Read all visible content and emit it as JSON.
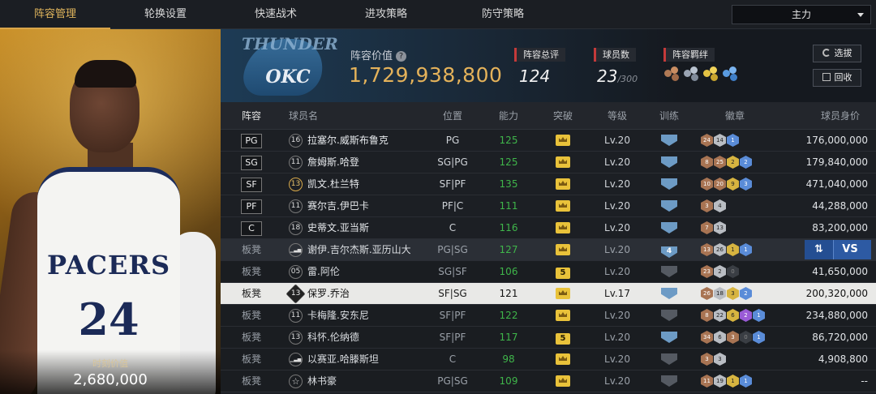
{
  "nav": {
    "tabs": [
      {
        "label": "阵容管理"
      },
      {
        "label": "轮换设置"
      },
      {
        "label": "快速战术"
      },
      {
        "label": "进攻策略"
      },
      {
        "label": "防守策略"
      }
    ],
    "lineup_select": "主力"
  },
  "portrait": {
    "jersey_team": "PACERS",
    "jersey_number": "24",
    "value_label": "时刻价值",
    "value_amount": "2,680,000"
  },
  "team": {
    "logo_text": "THUNDER",
    "logo_abbr": "OKC",
    "lineup_value_label": "阵容价值",
    "lineup_value": "1,729,938,800",
    "rating_label": "阵容总评",
    "rating": "124",
    "player_count_label": "球员数",
    "player_count": "23",
    "player_count_max": "/300",
    "bond_label": "阵容羁绊",
    "select_button": "选拔",
    "recycle_button": "回收"
  },
  "table": {
    "headers": {
      "lineup": "阵容",
      "name": "球员名",
      "position": "位置",
      "ability": "能力",
      "breakthrough": "突破",
      "level": "等级",
      "training": "训练",
      "badges": "徽章",
      "value": "球员身价"
    },
    "vs_label": "VS",
    "rows": [
      {
        "slot": "PG",
        "num": "16",
        "name": "拉塞尔.威斯布鲁克",
        "pos": "PG",
        "ability": "125",
        "level": "Lv.20",
        "value": "176,000,000"
      },
      {
        "slot": "SG",
        "num": "11",
        "name": "詹姆斯.哈登",
        "pos": "SG|PG",
        "ability": "125",
        "level": "Lv.20",
        "value": "179,840,000"
      },
      {
        "slot": "SF",
        "num": "13",
        "name": "凯文.杜兰特",
        "pos": "SF|PF",
        "ability": "135",
        "level": "Lv.20",
        "value": "471,040,000"
      },
      {
        "slot": "PF",
        "num": "11",
        "name": "赛尔吉.伊巴卡",
        "pos": "PF|C",
        "ability": "111",
        "level": "Lv.20",
        "value": "44,288,000"
      },
      {
        "slot": "C",
        "num": "18",
        "name": "史蒂文.亚当斯",
        "pos": "C",
        "ability": "116",
        "level": "Lv.20",
        "value": "83,200,000"
      },
      {
        "slot": "板凳",
        "num": "",
        "name": "谢伊.吉尔杰斯.亚历山大",
        "pos": "PG|SG",
        "ability": "127",
        "level": "Lv.20",
        "value": ""
      },
      {
        "slot": "板凳",
        "num": "05",
        "name": "雷.阿伦",
        "pos": "SG|SF",
        "ability": "106",
        "level": "Lv.20",
        "value": "41,650,000",
        "breakthrough": "5"
      },
      {
        "slot": "板凳",
        "num": "13",
        "name": "保罗.乔治",
        "pos": "SF|SG",
        "ability": "121",
        "level": "Lv.17",
        "value": "200,320,000"
      },
      {
        "slot": "板凳",
        "num": "11",
        "name": "卡梅隆.安东尼",
        "pos": "SF|PF",
        "ability": "122",
        "level": "Lv.20",
        "value": "234,880,000"
      },
      {
        "slot": "板凳",
        "num": "13",
        "name": "科怀.伦纳德",
        "pos": "SF|PF",
        "ability": "117",
        "level": "Lv.20",
        "value": "86,720,000",
        "breakthrough": "5"
      },
      {
        "slot": "板凳",
        "num": "",
        "name": "以赛亚.哈滕斯坦",
        "pos": "C",
        "ability": "98",
        "level": "Lv.20",
        "value": "4,908,800"
      },
      {
        "slot": "板凳",
        "num": "",
        "name": "林书豪",
        "pos": "PG|SG",
        "ability": "109",
        "level": "Lv.20",
        "value": "--"
      }
    ],
    "training_labels": [
      "",
      "",
      "",
      "",
      "",
      "4",
      "",
      "",
      "",
      "",
      "",
      ""
    ],
    "badges": [
      [
        "24",
        "14",
        "1"
      ],
      [
        "8",
        "25",
        "2",
        "2"
      ],
      [
        "10",
        "20",
        "9",
        "3"
      ],
      [
        "3",
        "4"
      ],
      [
        "7",
        "13"
      ],
      [
        "13",
        "26",
        "1",
        "1"
      ],
      [
        "23",
        "2",
        "0"
      ],
      [
        "26",
        "18",
        "3",
        "2"
      ],
      [
        "8",
        "22",
        "6",
        "2",
        "1"
      ],
      [
        "34",
        "6",
        "3",
        "0",
        "1"
      ],
      [
        "3",
        "3"
      ],
      [
        "11",
        "19",
        "1",
        "1"
      ]
    ]
  },
  "colors": {
    "accent_gold": "#e4b25a",
    "ability_green": "#3fb54a",
    "stat_red": "#c43a3a",
    "vs_blue": "#2d5aa3"
  }
}
